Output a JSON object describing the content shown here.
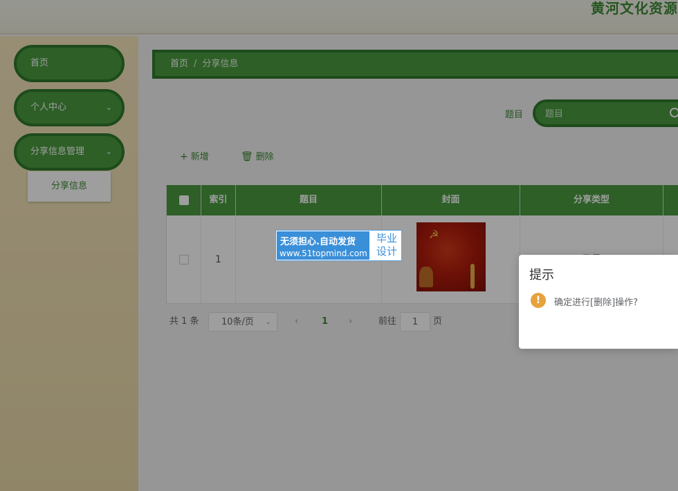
{
  "header": {
    "site_title": "黄河文化资源"
  },
  "sidebar": {
    "items": [
      {
        "label": "首页"
      },
      {
        "label": "个人中心"
      },
      {
        "label": "分享信息管理"
      }
    ],
    "submenu": [
      {
        "label": "分享信息"
      }
    ]
  },
  "breadcrumb": {
    "home": "首页",
    "separator": "/",
    "current": "分享信息"
  },
  "search": {
    "label": "题目",
    "placeholder": "题目"
  },
  "toolbar": {
    "add_label": "新增",
    "delete_label": "删除"
  },
  "table": {
    "columns": [
      "索引",
      "题目",
      "封面",
      "分享类型"
    ],
    "rows": [
      {
        "index": "1",
        "title": "",
        "type": "风景"
      }
    ]
  },
  "pagination": {
    "total": "共 1 条",
    "page_size": "10条/页",
    "current_page": "1",
    "goto_label": "前往",
    "goto_value": "1",
    "goto_suffix": "页"
  },
  "watermark": {
    "line1": "无须担心.自动发货",
    "line2": "www.51topmind.com",
    "right_top": "毕业",
    "right_bottom": "设计"
  },
  "dialog": {
    "title": "提示",
    "message": "确定进行[删除]操作?"
  },
  "colors": {
    "accent": "#4a9a40",
    "accent_dark": "#2f7a2c",
    "sidebar_bg": "#f4e5bd",
    "warning": "#e6a23c",
    "watermark_blue": "#3a8fd9"
  }
}
